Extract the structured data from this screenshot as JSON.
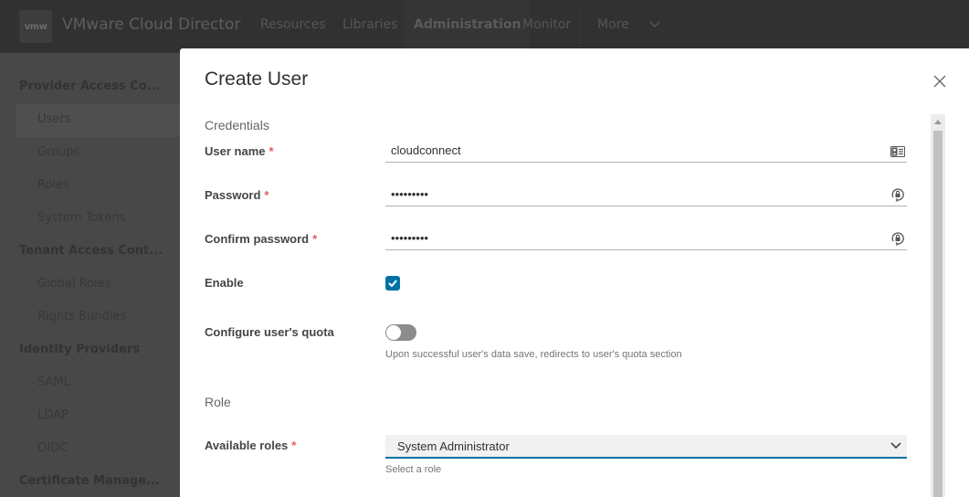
{
  "header": {
    "logo": "vmw",
    "app_title": "VMware Cloud Director",
    "nav": [
      {
        "label": "Resources",
        "active": false
      },
      {
        "label": "Libraries",
        "active": false
      },
      {
        "label": "Administration",
        "active": true
      },
      {
        "label": "Monitor",
        "active": false
      },
      {
        "label": "More",
        "active": false
      }
    ]
  },
  "sidebar": {
    "sections": [
      {
        "title": "Provider Access Co...",
        "items": [
          "Users",
          "Groups",
          "Roles",
          "System Tokens"
        ]
      },
      {
        "title": "Tenant Access Cont...",
        "items": [
          "Global Roles",
          "Rights Bundles"
        ]
      },
      {
        "title": "Identity Providers",
        "items": [
          "SAML",
          "LDAP",
          "OIDC"
        ]
      },
      {
        "title": "Certificate Manage...",
        "items": []
      }
    ],
    "active_item": "Users"
  },
  "modal": {
    "title": "Create User",
    "credentials_section": "Credentials",
    "fields": {
      "username": {
        "label": "User name",
        "required": "*",
        "value": "cloudconnect",
        "icon": "id-card-icon"
      },
      "password": {
        "label": "Password",
        "required": "*",
        "value": "•••••••••",
        "icon": "password-reveal-icon"
      },
      "confirm_password": {
        "label": "Confirm password",
        "required": "*",
        "value": "•••••••••",
        "icon": "password-reveal-icon"
      },
      "enable": {
        "label": "Enable",
        "checked": true
      },
      "quota": {
        "label": "Configure user's quota",
        "on": false,
        "helper": "Upon successful user's data save, redirects to user's quota section"
      }
    },
    "role_section": "Role",
    "available_roles": {
      "label": "Available roles",
      "required": "*",
      "value": "System Administrator",
      "helper": "Select a role"
    }
  },
  "colors": {
    "accent": "#0072a3",
    "required": "#e25a5a"
  }
}
